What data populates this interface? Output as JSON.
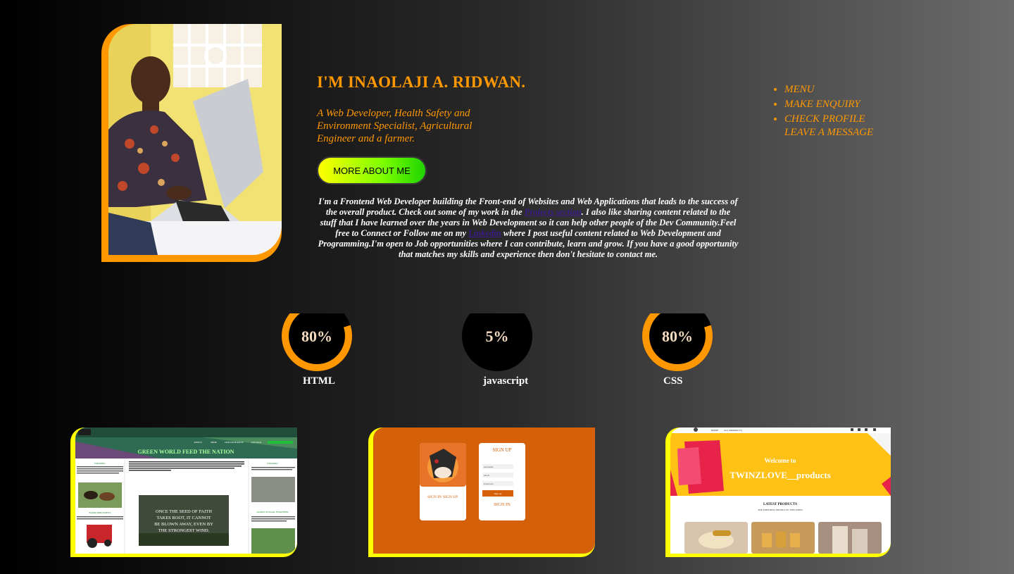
{
  "hero": {
    "title": "I'M INAOLAJI A. RIDWAN.",
    "subtitle": "A Web Developer, Health Safety and Environment Specialist, Agricultural Engineer and a farmer.",
    "button_label": "MORE ABOUT ME",
    "bio_part1": "I'm a Frontend Web Developer building the Front-end of Websites and Web Applications that leads to the success of the overall product. Check out some of my work in the ",
    "bio_link1": "Projects section",
    "bio_part2": ". I also like sharing content related to the stuff that I have learned over the years in Web Development so it can help other people of the Dev Community.Feel free to Connect or Follow me on my ",
    "bio_link2": "Linkedin",
    "bio_part3": " where I post useful content related to Web Development and Programming.I'm open to Job opportunities where I can contribute, learn and grow. If you have a good opportunity that matches my skills and experience then don't hesitate to contact me."
  },
  "menu": {
    "items": [
      "MENU",
      "MAKE ENQUIRY",
      "CHECK PROFILE"
    ],
    "extra": "LEAVE A MESSAGE"
  },
  "skills": [
    {
      "label": "HTML",
      "percent_text": "80%",
      "percent": 80
    },
    {
      "label": "javascript",
      "percent_text": "5%",
      "percent": 5
    },
    {
      "label": "CSS",
      "percent_text": "80%",
      "percent": 80
    }
  ],
  "projects": {
    "p1": {
      "banner": "GREEN WORLD FEED THE NATION",
      "nav": [
        "ABOUT",
        "SHOP",
        "OUR RESEARCH",
        "UPLOAD"
      ],
      "col1_head": "FARMING",
      "col1_sub": "FARM IMPLEMENT",
      "col3_head": "FARMING",
      "col3_sub": "AGRICULTURAL ENGINEER",
      "intro": "The history of agriculture is the story of humankind's development and cultivation of processes for producing food, feed, fiber, fuel, and other goods by the systematic raising of plants and animals.",
      "quote": "ONCE THE SEED OF FAITH TAKES ROOT, IT CANNOT BE BLOWN AWAY, EVEN BY THE STRONGEST WIND."
    },
    "p2": {
      "card_title": "SIGN UP",
      "tab_signin": "SIGN IN",
      "tab_signup": "SIGN UP",
      "field_username": "username",
      "field_email": "email",
      "field_password": "Password",
      "submit": "Sign up",
      "footer_link": "SIGN IN"
    },
    "p3": {
      "nav": [
        "HOME",
        "ALL PRODUCTS"
      ],
      "welcome": "Welcome to",
      "brand": "TWINZLOVE__products",
      "section": "LATEST PRODUCTS",
      "section_sub": "TOP TRENDING PRODUCTS THIS WEEK"
    }
  },
  "colors": {
    "accent": "#ff9800",
    "project_border": "#ffff00",
    "signup_bg": "#d4600a"
  }
}
